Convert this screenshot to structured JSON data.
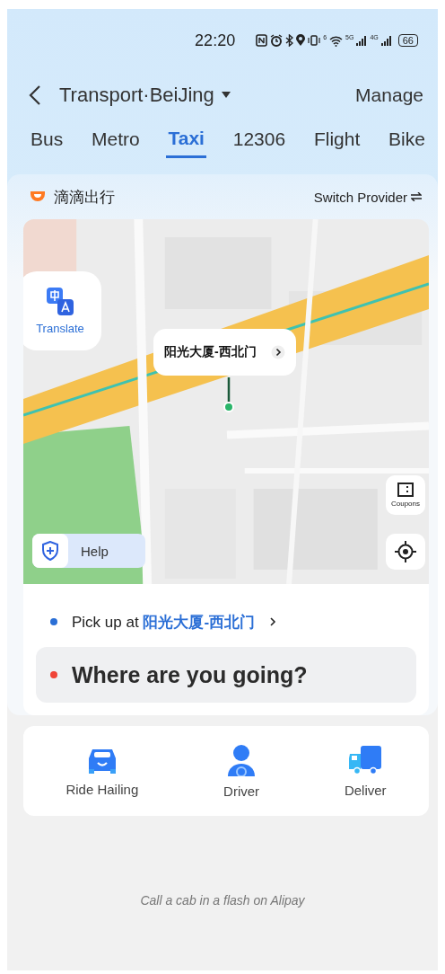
{
  "status_bar": {
    "time": "22:20",
    "wifi_label": "6",
    "networks": [
      "5G",
      "4G"
    ],
    "battery": "66"
  },
  "header": {
    "title": "Transport·BeiJing",
    "action": "Manage"
  },
  "tabs": [
    {
      "label": "Bus",
      "selected": false
    },
    {
      "label": "Metro",
      "selected": false
    },
    {
      "label": "Taxi",
      "selected": true
    },
    {
      "label": "12306",
      "selected": false
    },
    {
      "label": "Flight",
      "selected": false
    },
    {
      "label": "Bike",
      "selected": false
    }
  ],
  "provider": {
    "name": "滴滴出行",
    "switch": "Switch Provider"
  },
  "map": {
    "kind": "picture",
    "translate": "Translate",
    "callout": "阳光大厦-西北门",
    "help": "Help",
    "coupons": "Coupons"
  },
  "pickup": {
    "prefix": "Pick up at",
    "place": "阳光大厦-西北门"
  },
  "destination": {
    "placeholder": "Where are you going?"
  },
  "services": [
    {
      "label": "Ride Hailing",
      "kind": "car"
    },
    {
      "label": "Driver",
      "kind": "driver"
    },
    {
      "label": "Deliver",
      "kind": "truck"
    }
  ],
  "footer": "Call a cab in a flash on Alipay"
}
